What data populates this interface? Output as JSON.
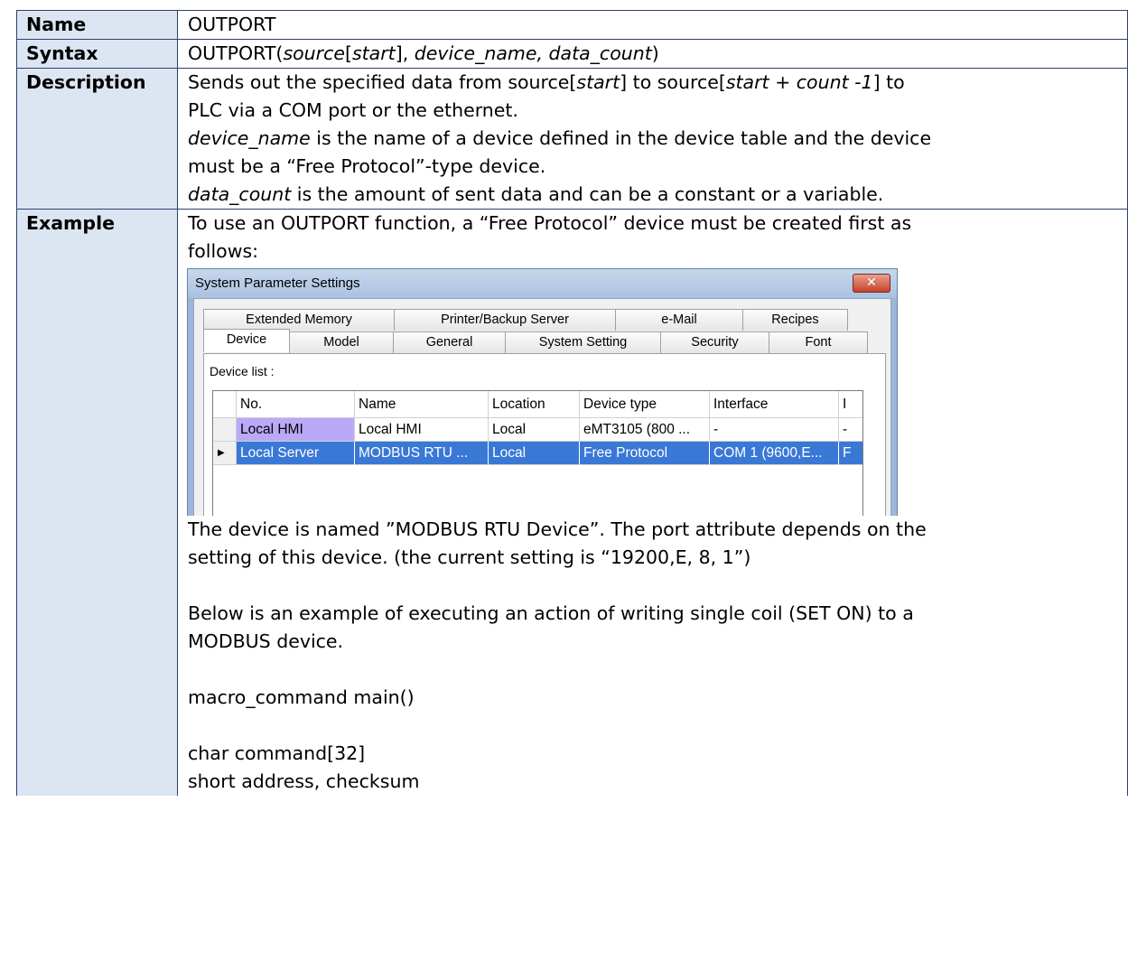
{
  "rows": {
    "name": {
      "label": "Name",
      "value": "OUTPORT"
    },
    "syntax": {
      "label": "Syntax",
      "prefix": "OUTPORT(",
      "source": "source",
      "lbracket": "[",
      "start": "start",
      "rest": "], ",
      "device_name": "device_name, data_count",
      "close": ")"
    },
    "description": {
      "label": "Description",
      "line1_a": "Sends out the specified data from source[",
      "line1_b": "start",
      "line1_c": "] to source[",
      "line1_d": "start + count -1",
      "line1_e": "] to",
      "line2": "PLC via a COM port or the ethernet.",
      "line3_a": "device_name",
      "line3_b": " is the name of a device defined in the device table and the device",
      "line4": "must be a “Free Protocol”-type device.",
      "line5_a": "data_count",
      "line5_b": " is the amount of sent data and can be a constant or a variable."
    },
    "example": {
      "label": "Example",
      "intro1": "To use an OUTPORT function, a “Free Protocol” device must be created first as",
      "intro2": "follows:",
      "after1": "The device is named ”MODBUS RTU Device”. The port attribute depends on the",
      "after2": "setting of this device. (the current setting is “19200,E, 8, 1”)",
      "below1": "Below is an example of executing an action of writing single coil (SET ON) to a",
      "below2": "MODBUS device.",
      "code1": "macro_command main()",
      "code2": "char command[32]",
      "code3": "short address, checksum"
    }
  },
  "dialog": {
    "title": "System Parameter Settings",
    "close_glyph": "✕",
    "tabs_row1": [
      "Extended Memory",
      "Printer/Backup Server",
      "e-Mail",
      "Recipes"
    ],
    "tabs_row2": [
      "Device",
      "Model",
      "General",
      "System Setting",
      "Security",
      "Font"
    ],
    "device_list_label": "Device list :",
    "columns": [
      "No.",
      "Name",
      "Location",
      "Device type",
      "Interface",
      "I"
    ],
    "device_rows": [
      {
        "no": "Local HMI",
        "name": "Local HMI",
        "location": "Local",
        "type": "eMT3105 (800 ...",
        "interface": "-",
        "extra": "-"
      },
      {
        "no": "Local Server",
        "name": "MODBUS RTU ...",
        "location": "Local",
        "type": "Free Protocol",
        "interface": "COM 1 (9600,E...",
        "extra": "F"
      }
    ],
    "row_arrow": "▶"
  }
}
